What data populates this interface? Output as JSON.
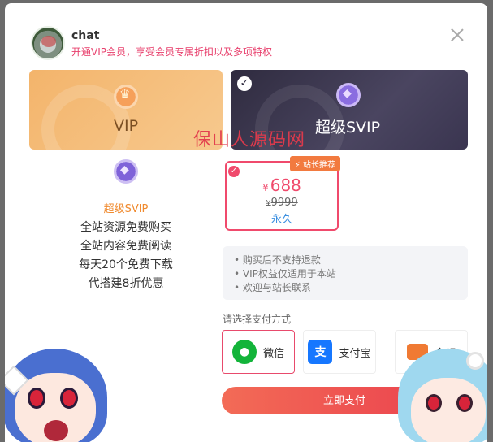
{
  "header": {
    "username": "chat",
    "tagline": "开通VIP会员，享受会员专属折扣以及多项特权"
  },
  "plans": [
    {
      "name": "VIP",
      "selected": false
    },
    {
      "name": "超级SVIP",
      "selected": true,
      "check": "✓"
    }
  ],
  "watermark": "保山人源码网",
  "plan_detail": {
    "title": "超级SVIP",
    "perks": [
      "全站资源免费购买",
      "全站内容免费阅读",
      "每天20个免费下载",
      "代搭建8折优惠"
    ]
  },
  "price_option": {
    "badge": "站长推荐",
    "currency": "¥",
    "price": "688",
    "original_price": "9999",
    "duration": "永久",
    "check": "✓"
  },
  "notices": [
    "购买后不支持退款",
    "VIP权益仅适用于本站",
    "欢迎与站长联系"
  ],
  "payment": {
    "label": "请选择支付方式",
    "methods": [
      {
        "name": "微信",
        "icon": "wechat-icon",
        "selected": true
      },
      {
        "name": "支付宝",
        "icon": "alipay-icon",
        "glyph": "支",
        "selected": false
      },
      {
        "name": "余额",
        "icon": "balance-icon",
        "selected": false
      }
    ],
    "submit": "立即支付"
  },
  "colors": {
    "accent": "#f04a6c",
    "tagline": "#e8406d",
    "vip_card": "#f3b46b",
    "svip_card": "#2f2b3f",
    "pay_button": "#ea3f4e",
    "wechat": "#13b43a",
    "alipay": "#1677ff",
    "balance": "#f07a33"
  }
}
